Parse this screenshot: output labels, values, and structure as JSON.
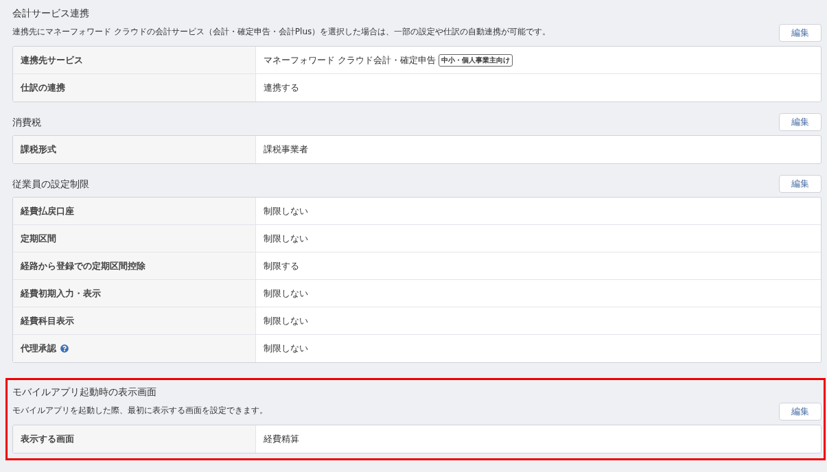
{
  "sections": [
    {
      "title": "会計サービス連携",
      "description": "連携先にマネーフォワード クラウドの会計サービス（会計・確定申告・会計Plus）を選択した場合は、一部の設定や仕訳の自動連携が可能です。",
      "edit_button": "編集",
      "highlighted": false,
      "rows": [
        {
          "label": "連携先サービス",
          "value": "マネーフォワード クラウド会計・確定申告",
          "badge": "中小・個人事業主向け",
          "help": false
        },
        {
          "label": "仕訳の連携",
          "value": "連携する",
          "help": false
        }
      ]
    },
    {
      "title": "消費税",
      "edit_button": "編集",
      "highlighted": false,
      "rows": [
        {
          "label": "課税形式",
          "value": "課税事業者",
          "help": false
        }
      ]
    },
    {
      "title": "従業員の設定制限",
      "edit_button": "編集",
      "highlighted": false,
      "rows": [
        {
          "label": "経費払戻口座",
          "value": "制限しない",
          "help": false
        },
        {
          "label": "定期区間",
          "value": "制限しない",
          "help": false
        },
        {
          "label": "経路から登録での定期区間控除",
          "value": "制限する",
          "help": false
        },
        {
          "label": "経費初期入力・表示",
          "value": "制限しない",
          "help": false
        },
        {
          "label": "経費科目表示",
          "value": "制限しない",
          "help": false
        },
        {
          "label": "代理承認",
          "value": "制限しない",
          "help": true
        }
      ]
    },
    {
      "title": "モバイルアプリ起動時の表示画面",
      "description": "モバイルアプリを起動した際、最初に表示する画面を設定できます。",
      "edit_button": "編集",
      "highlighted": true,
      "rows": [
        {
          "label": "表示する画面",
          "value": "経費精算",
          "help": false
        }
      ]
    }
  ]
}
